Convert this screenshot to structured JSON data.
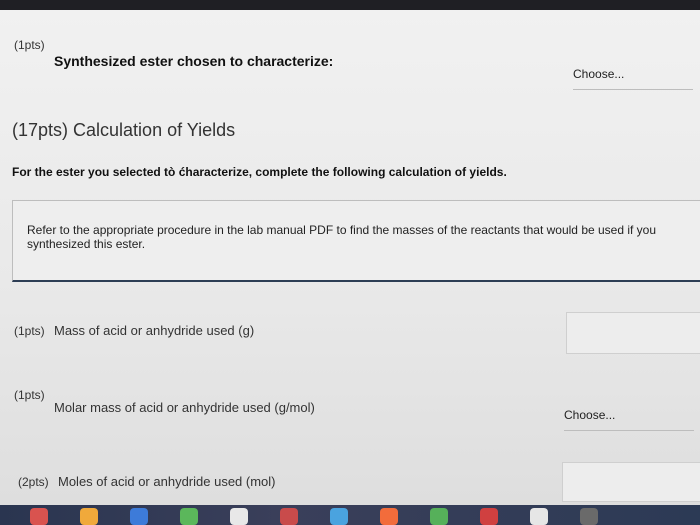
{
  "q1": {
    "points": "(1pts)",
    "label": "Synthesized ester chosen to characterize:",
    "select_value": "Choose..."
  },
  "section": {
    "heading": "(17pts) Calculation of Yields",
    "instructions": "For the ester you selected tò ćharacterize, complete the following calculation of yields.",
    "info_text": "Refer to the appropriate procedure in the lab manual PDF to find the masses of the reactants that would be used if you synthesized this ester."
  },
  "q2": {
    "points": "(1pts)",
    "label": "Mass of acid or anhydride used (g)",
    "value": ""
  },
  "q3": {
    "points": "(1pts)",
    "label": "Molar mass of acid or anhydride used (g/mol)",
    "select_value": "Choose..."
  },
  "q4": {
    "points": "(2pts)",
    "label": "Moles of acid or anhydride used (mol)",
    "value": ""
  },
  "dock": {
    "icons": [
      {
        "name": "dock-app-icon-1",
        "color": "#d9534f"
      },
      {
        "name": "dock-app-icon-2",
        "color": "#f0a93b"
      },
      {
        "name": "dock-app-icon-3",
        "color": "#3d7bd9"
      },
      {
        "name": "dock-app-icon-4",
        "color": "#5bb75b"
      },
      {
        "name": "dock-app-icon-5",
        "color": "#e8e8e8"
      },
      {
        "name": "dock-app-icon-6",
        "color": "#c94b4b"
      },
      {
        "name": "dock-app-icon-7",
        "color": "#4aa3df"
      },
      {
        "name": "dock-app-icon-8",
        "color": "#f26c3b"
      },
      {
        "name": "dock-app-icon-9",
        "color": "#56b05a"
      },
      {
        "name": "dock-app-icon-10",
        "color": "#d04040"
      },
      {
        "name": "dock-app-icon-11",
        "color": "#e6e6e6"
      },
      {
        "name": "dock-app-icon-12",
        "color": "#6a6a6a"
      }
    ]
  }
}
